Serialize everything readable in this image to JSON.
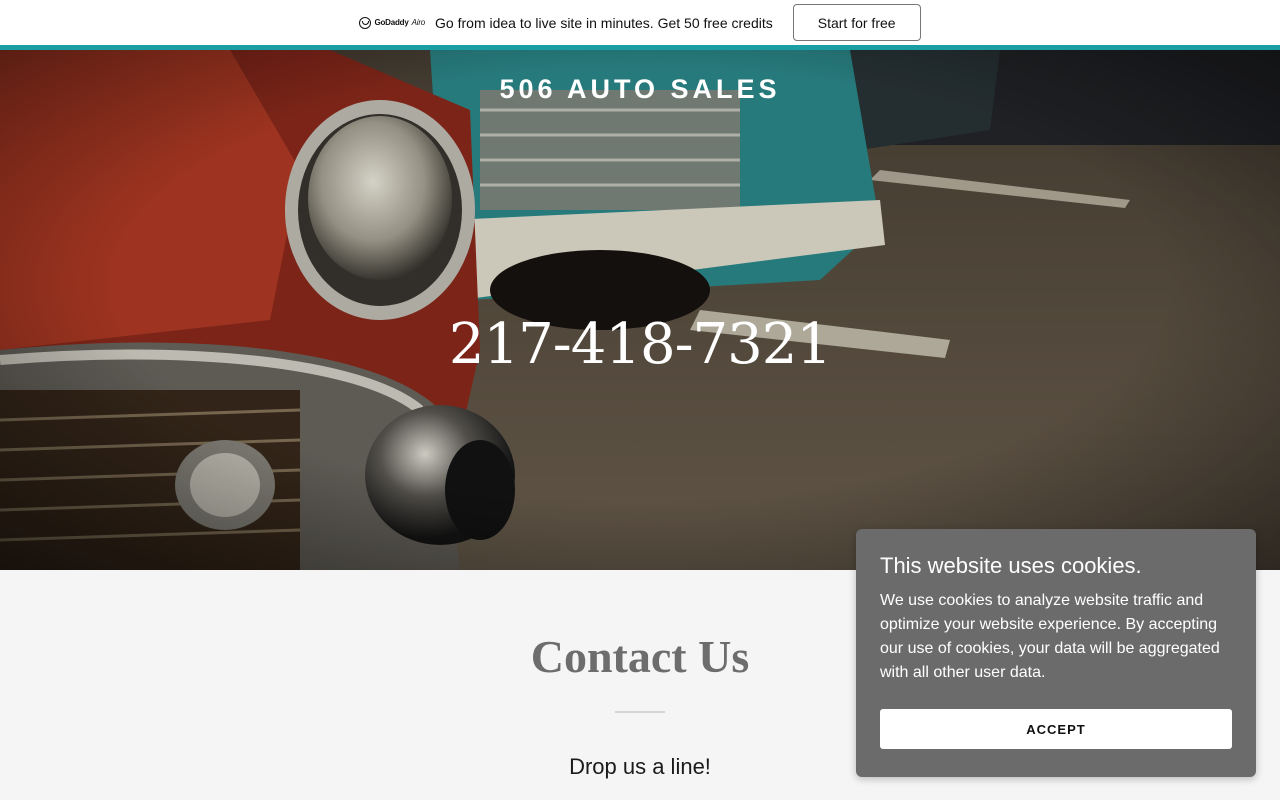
{
  "promo": {
    "logo_text": "GoDaddy",
    "logo_suffix": "Airo",
    "message": "Go from idea to live site in minutes. Get 50 free credits",
    "cta_label": "Start for free"
  },
  "hero": {
    "site_title": "506 AUTO SALES",
    "phone": "217-418-7321"
  },
  "contact": {
    "title": "Contact Us",
    "subtitle": "Drop us a line!"
  },
  "cookie": {
    "title": "This website uses cookies.",
    "body": "We use cookies to analyze website traffic and optimize your website experience. By accepting our use of cookies, your data will be aggregated with all other user data.",
    "accept_label": "ACCEPT"
  },
  "colors": {
    "accent": "#1a9ea4",
    "cookie_bg": "#6b6b6b",
    "page_bg": "#f5f5f5"
  }
}
